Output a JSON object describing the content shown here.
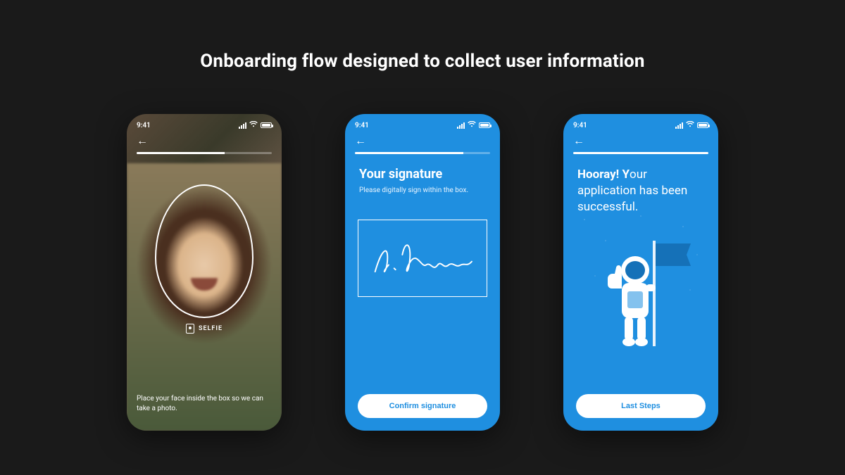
{
  "page": {
    "title": "Onboarding flow designed to collect user information"
  },
  "statusbar": {
    "time": "9:41"
  },
  "screen1": {
    "progress_pct": 65,
    "selfie_label": "SELFIE",
    "instruction": "Place your face inside the box so we can take a photo."
  },
  "screen2": {
    "progress_pct": 80,
    "heading": "Your signature",
    "subtext": "Please digitally sign within the box.",
    "signature_sample": "S. Williams",
    "cta": "Confirm signature"
  },
  "screen3": {
    "progress_pct": 100,
    "heading_bold": "Hooray! Y",
    "heading_rest": "our application has been successful.",
    "cta": "Last Steps"
  },
  "colors": {
    "brand_blue": "#1f8fe0",
    "bg": "#1a1a1a"
  }
}
